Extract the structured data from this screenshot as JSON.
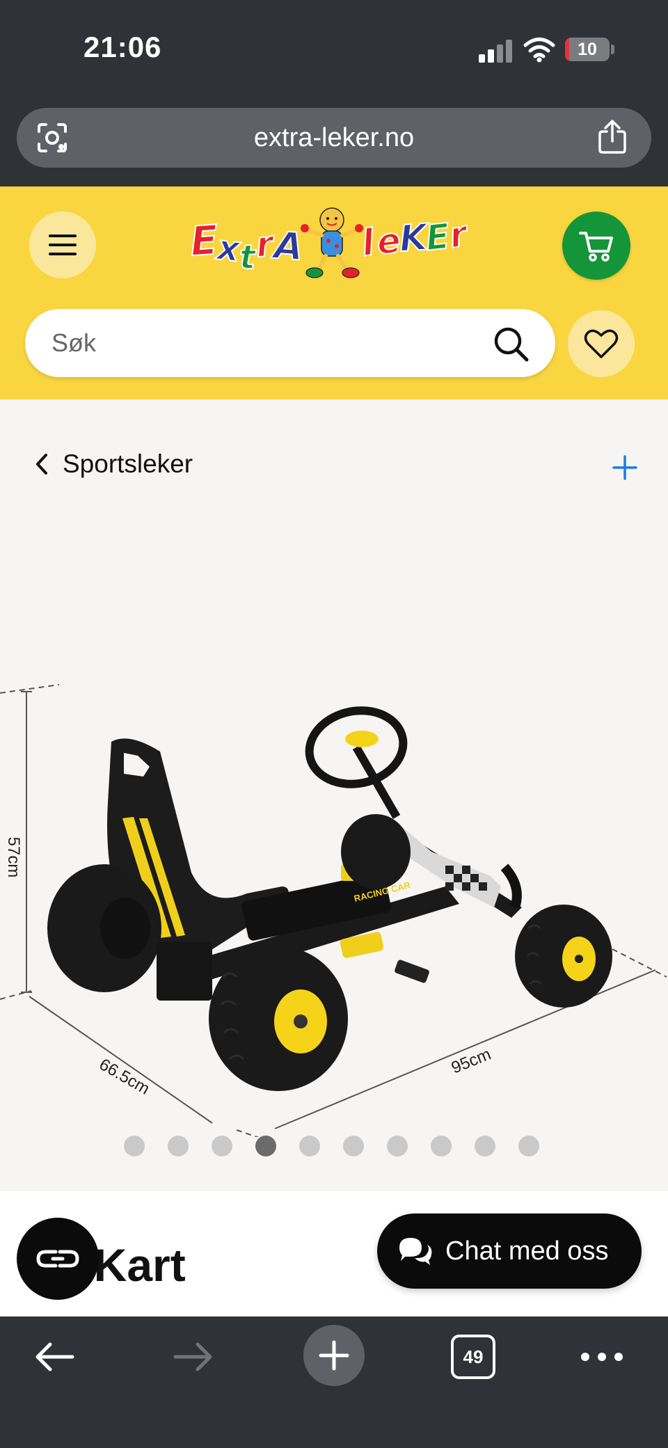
{
  "status_bar": {
    "time": "21:06",
    "battery": "10",
    "icons": [
      "signal-icon",
      "wifi-icon",
      "battery-icon"
    ]
  },
  "browser": {
    "url": "extra-leker.no",
    "tab_count": "49",
    "icons": [
      "lens-icon",
      "share-icon",
      "back-arrow-icon",
      "forward-arrow-icon",
      "plus-icon",
      "tabs-icon",
      "more-icon"
    ]
  },
  "header": {
    "logo_text": "Extra Leker",
    "search_placeholder": "Søk",
    "colors": {
      "header_bg": "#f9d53f",
      "cart_bg": "#159539",
      "button_bg": "#fbe79b"
    }
  },
  "breadcrumb": {
    "label": "Sportsleker"
  },
  "product": {
    "image_dimensions": {
      "height": "57cm",
      "width": "66.5cm",
      "length": "95cm",
      "badge": "RACING CAR"
    },
    "carousel": {
      "count": 10,
      "active_index": 3
    },
    "title_partial": "o Kart"
  },
  "chat": {
    "label": "Chat med oss"
  }
}
